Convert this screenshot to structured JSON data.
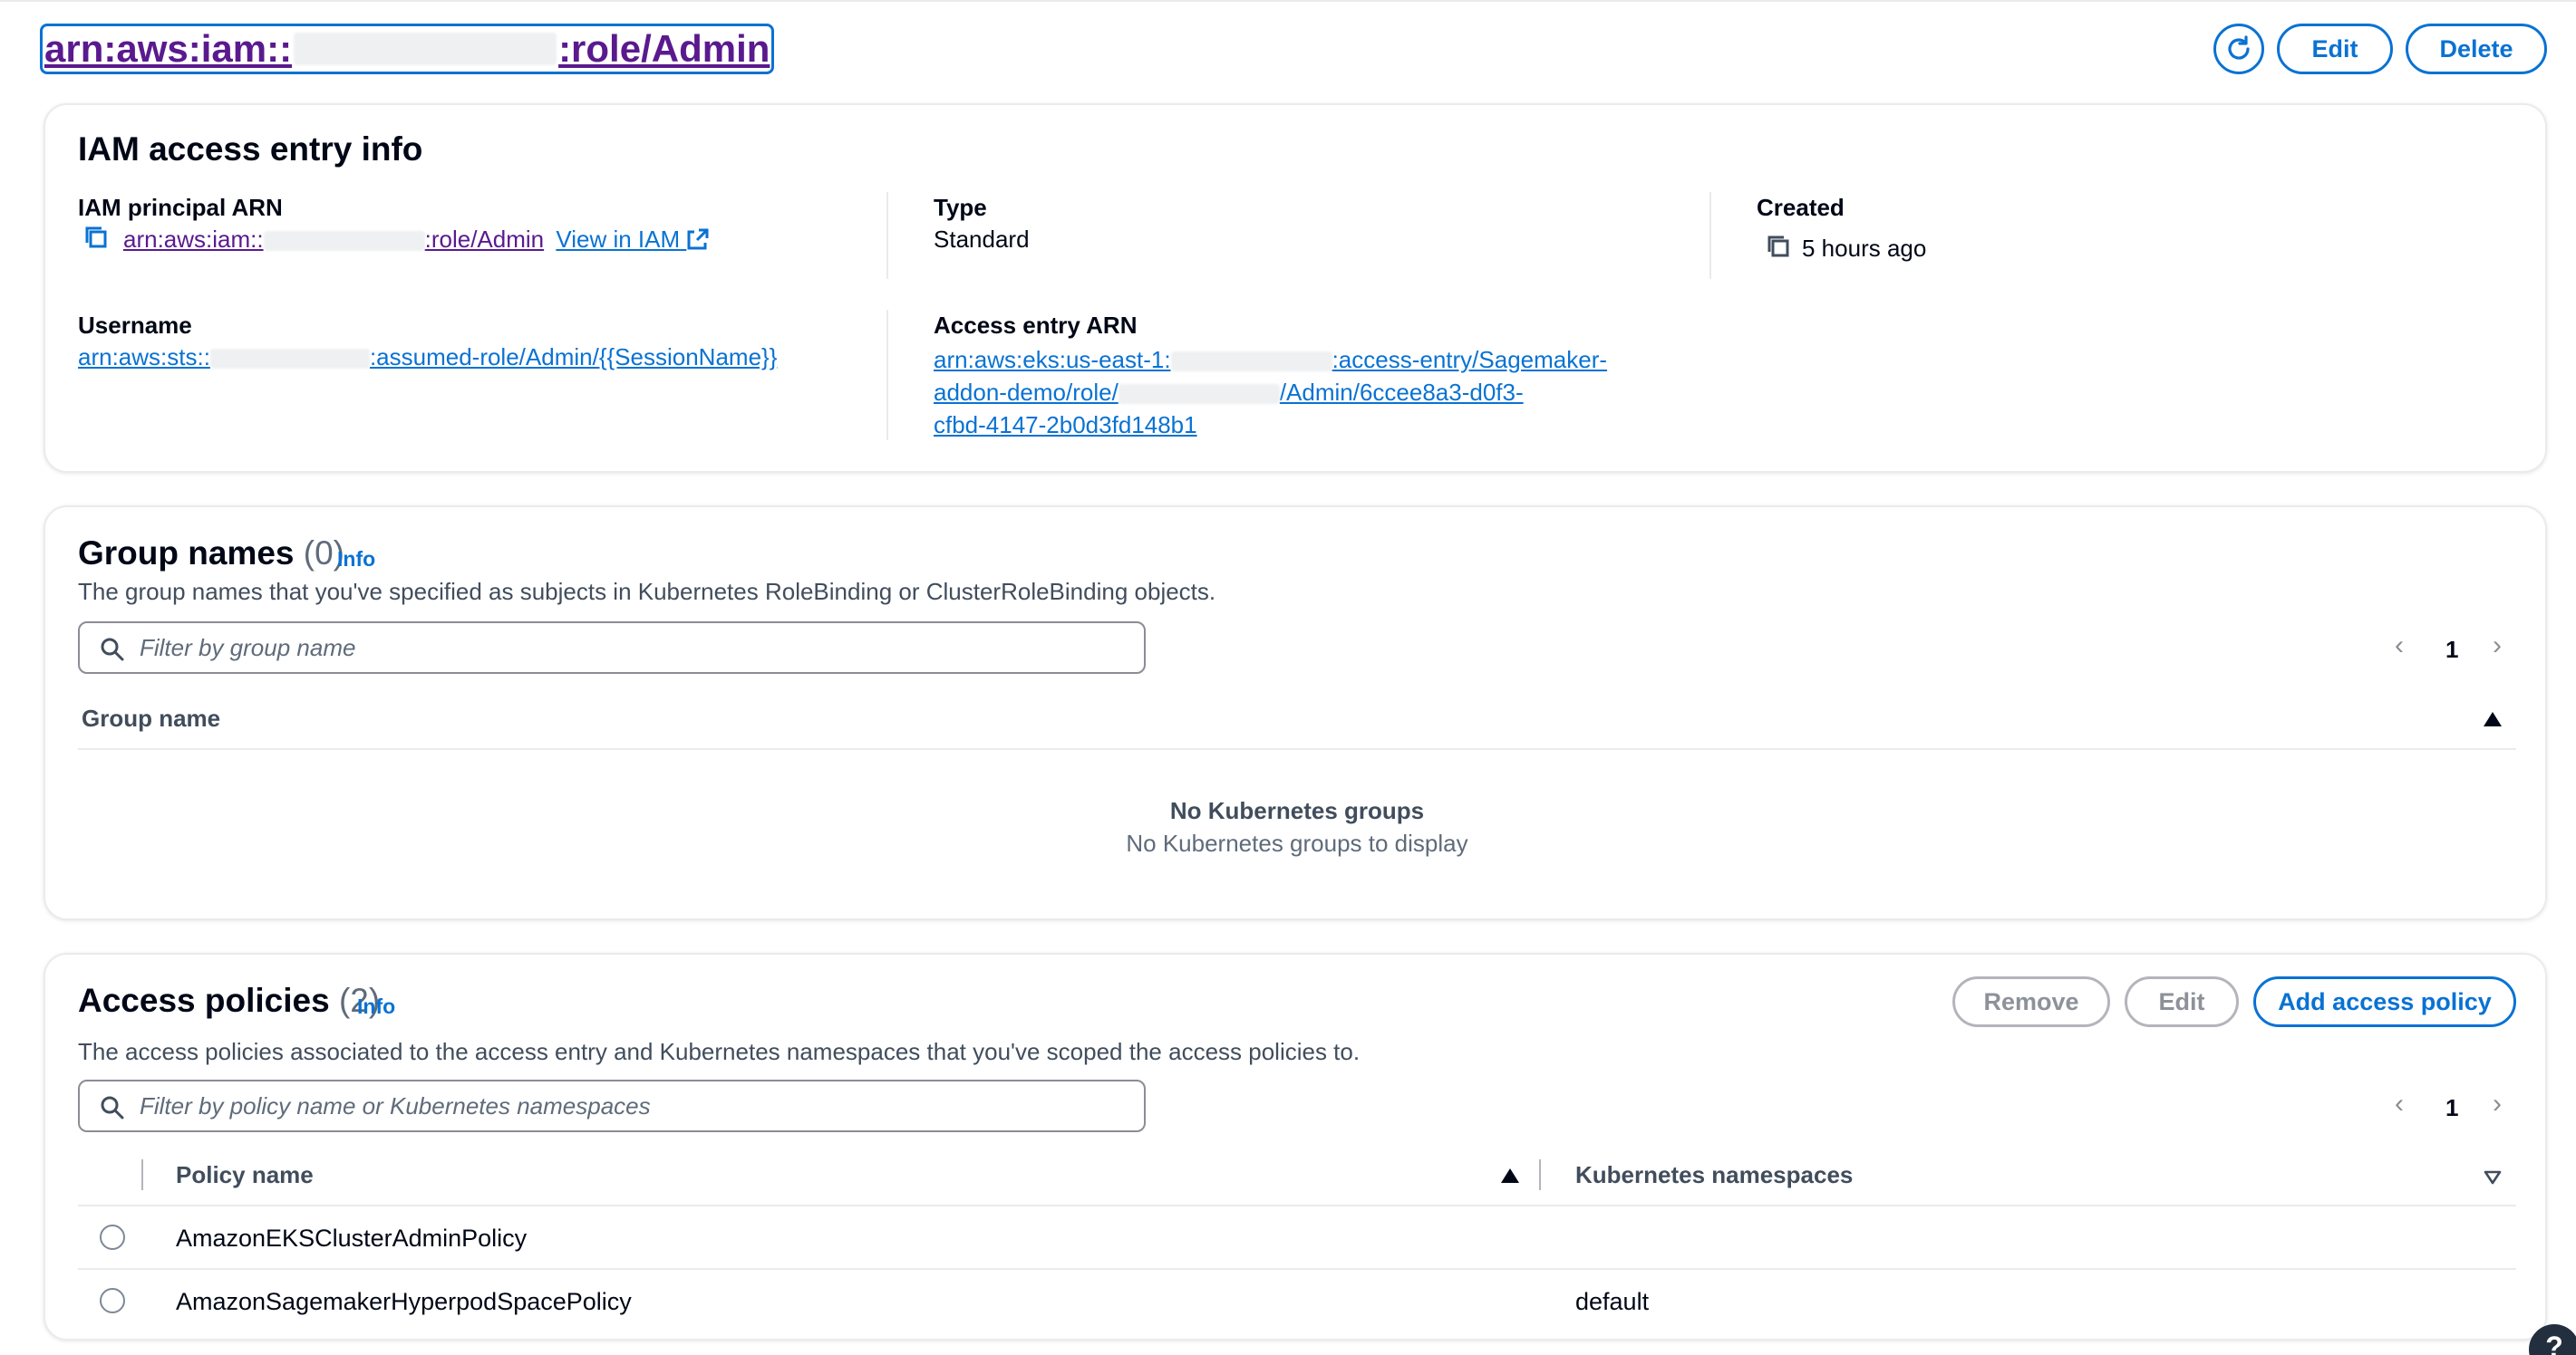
{
  "header": {
    "title_prefix": "arn:aws:iam::",
    "title_suffix": ":role/Admin",
    "edit_label": "Edit",
    "delete_label": "Delete"
  },
  "info_card": {
    "title": "IAM access entry info",
    "principal_label": "IAM principal ARN",
    "principal_prefix": "arn:aws:iam::",
    "principal_suffix": ":role/Admin",
    "view_in_iam": "View in IAM",
    "type_label": "Type",
    "type_value": "Standard",
    "created_label": "Created",
    "created_value": "5 hours ago",
    "username_label": "Username",
    "username_prefix": "arn:aws:sts::",
    "username_suffix": ":assumed-role/Admin/{{SessionName}}",
    "access_entry_label": "Access entry ARN",
    "access_entry_line1_prefix": "arn:aws:eks:us-east-1:",
    "access_entry_line1_suffix": ":access-entry/Sagemaker-",
    "access_entry_line2_prefix": "addon-demo/role/",
    "access_entry_line2_suffix": "/Admin/6ccee8a3-d0f3-",
    "access_entry_line3": "cfbd-4147-2b0d3fd148b1"
  },
  "groups_card": {
    "title": "Group names",
    "count": "(0)",
    "info": "Info",
    "description": "The group names that you've specified as subjects in Kubernetes RoleBinding or ClusterRoleBinding objects.",
    "filter_placeholder": "Filter by group name",
    "page": "1",
    "column_header": "Group name",
    "empty_title": "No Kubernetes groups",
    "empty_subtitle": "No Kubernetes groups to display"
  },
  "policies_card": {
    "title": "Access policies",
    "count": "(2)",
    "info": "Info",
    "remove_label": "Remove",
    "edit_label": "Edit",
    "add_label": "Add access policy",
    "description": "The access policies associated to the access entry and Kubernetes namespaces that you've scoped the access policies to.",
    "filter_placeholder": "Filter by policy name or Kubernetes namespaces",
    "page": "1",
    "columns": [
      "Policy name",
      "Kubernetes namespaces"
    ],
    "rows": [
      {
        "policy": "AmazonEKSClusterAdminPolicy",
        "namespaces": ""
      },
      {
        "policy": "AmazonSagemakerHyperpodSpacePolicy",
        "namespaces": "default"
      }
    ]
  },
  "colors": {
    "accent": "#0972d3",
    "visited": "#5a1a8e",
    "border": "#e9ebed"
  },
  "icons": [
    "refresh-icon",
    "copy-icon",
    "external-link-icon",
    "search-icon",
    "chevron-left-icon",
    "chevron-right-icon",
    "sort-ascending-icon",
    "sort-descending-icon",
    "help-icon"
  ]
}
